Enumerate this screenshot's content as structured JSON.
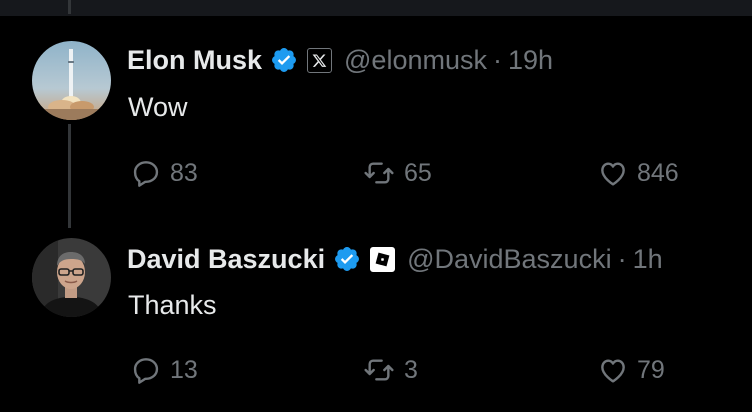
{
  "tweets": [
    {
      "author": "Elon Musk",
      "handle": "@elonmusk",
      "separator": "·",
      "time": "19h",
      "text": "Wow",
      "replies": "83",
      "retweets": "65",
      "likes": "846",
      "affiliation_icon": "x-logo-icon"
    },
    {
      "author": "David Baszucki",
      "handle": "@DavidBaszucki",
      "separator": "·",
      "time": "1h",
      "text": "Thanks",
      "replies": "13",
      "retweets": "3",
      "likes": "79",
      "affiliation_icon": "roblox-logo-icon"
    }
  ],
  "colors": {
    "background": "#000000",
    "text": "#e7e9ea",
    "muted": "#71767b",
    "verified": "#1d9bf0",
    "thread_line": "#333639"
  }
}
